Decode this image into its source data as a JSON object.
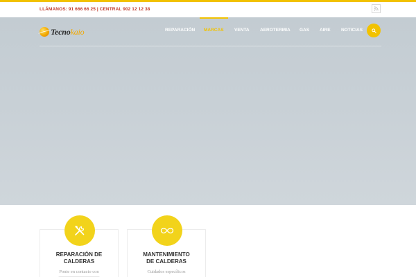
{
  "topbar": {
    "phones": "LLÁMANOS: 91 666 66 25 | CENTRAL 902 12 12 38",
    "rss_icon": "rss-icon"
  },
  "colors": {
    "accent": "#f2c200",
    "phone_text": "#c0392b",
    "icon_circle": "#f2d31b"
  },
  "header": {
    "logo": {
      "main": "Tecno",
      "highlight": "kaio"
    },
    "nav": [
      {
        "label": "REPARACIÓN",
        "active": false
      },
      {
        "label": "MARCAS",
        "active": true
      },
      {
        "label": "VENTA",
        "active": false
      },
      {
        "label": "AEROTERMIA",
        "active": false
      },
      {
        "label": "GAS",
        "active": false
      },
      {
        "label": "AIRE",
        "active": false
      },
      {
        "label": "NOTICIAS",
        "active": false
      }
    ],
    "search_icon": "search-icon"
  },
  "services": [
    {
      "icon": "tools-icon",
      "title_line1": "REPARACIÓN DE",
      "title_line2": "CALDERAS",
      "text": "Ponte en contacto con"
    },
    {
      "icon": "infinity-icon",
      "title_line1": "MANTENIMIENTO",
      "title_line2": "DE CALDERAS",
      "text": "Cuidados específicos"
    }
  ]
}
